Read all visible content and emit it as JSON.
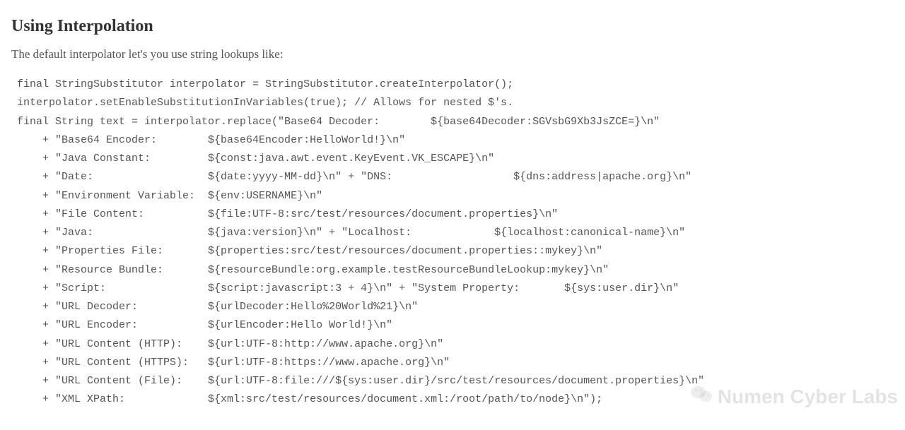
{
  "heading": "Using Interpolation",
  "intro": "The default interpolator let's you use string lookups like:",
  "code": "final StringSubstitutor interpolator = StringSubstitutor.createInterpolator();\ninterpolator.setEnableSubstitutionInVariables(true); // Allows for nested $'s.\nfinal String text = interpolator.replace(\"Base64 Decoder:        ${base64Decoder:SGVsbG9Xb3JsZCE=}\\n\"\n    + \"Base64 Encoder:        ${base64Encoder:HelloWorld!}\\n\"\n    + \"Java Constant:         ${const:java.awt.event.KeyEvent.VK_ESCAPE}\\n\"\n    + \"Date:                  ${date:yyyy-MM-dd}\\n\" + \"DNS:                   ${dns:address|apache.org}\\n\"\n    + \"Environment Variable:  ${env:USERNAME}\\n\"\n    + \"File Content:          ${file:UTF-8:src/test/resources/document.properties}\\n\"\n    + \"Java:                  ${java:version}\\n\" + \"Localhost:             ${localhost:canonical-name}\\n\"\n    + \"Properties File:       ${properties:src/test/resources/document.properties::mykey}\\n\"\n    + \"Resource Bundle:       ${resourceBundle:org.example.testResourceBundleLookup:mykey}\\n\"\n    + \"Script:                ${script:javascript:3 + 4}\\n\" + \"System Property:       ${sys:user.dir}\\n\"\n    + \"URL Decoder:           ${urlDecoder:Hello%20World%21}\\n\"\n    + \"URL Encoder:           ${urlEncoder:Hello World!}\\n\"\n    + \"URL Content (HTTP):    ${url:UTF-8:http://www.apache.org}\\n\"\n    + \"URL Content (HTTPS):   ${url:UTF-8:https://www.apache.org}\\n\"\n    + \"URL Content (File):    ${url:UTF-8:file:///${sys:user.dir}/src/test/resources/document.properties}\\n\"\n    + \"XML XPath:             ${xml:src/test/resources/document.xml:/root/path/to/node}\\n\");",
  "watermark": "Numen Cyber Labs"
}
